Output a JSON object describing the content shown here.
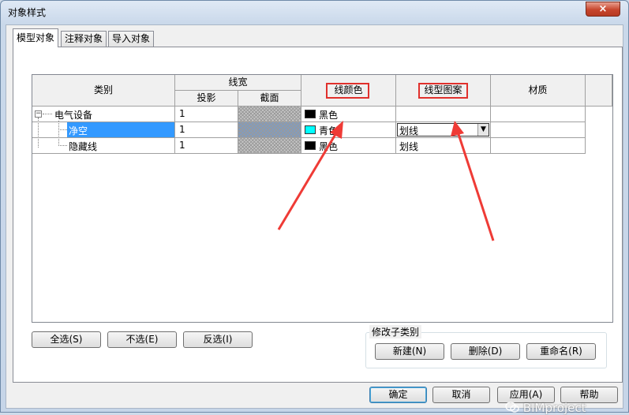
{
  "window": {
    "title": "对象样式",
    "close_icon": "×"
  },
  "tabs": [
    {
      "label": "模型对象",
      "active": true
    },
    {
      "label": "注释对象",
      "active": false
    },
    {
      "label": "导入对象",
      "active": false
    }
  ],
  "grid": {
    "headers": {
      "category": "类别",
      "line_weight": "线宽",
      "projection": "投影",
      "cut": "截面",
      "line_color": "线颜色",
      "line_pattern": "线型图案",
      "material": "材质"
    },
    "rows": [
      {
        "name": "电气设备",
        "projection": "1",
        "color_name": "黑色",
        "color_hex": "#000000",
        "pattern": "",
        "expander": "−"
      },
      {
        "name": "净空",
        "projection": "1",
        "color_name": "青色",
        "color_hex": "#00ffff",
        "pattern": "划线",
        "selected": true
      },
      {
        "name": "隐藏线",
        "projection": "1",
        "color_name": "黑色",
        "color_hex": "#000000",
        "pattern": "划线"
      }
    ]
  },
  "buttons": {
    "select_all": "全选(S)",
    "select_none": "不选(E)",
    "invert": "反选(I)",
    "modify_subcategory": "修改子类别",
    "new": "新建(N)",
    "delete": "删除(D)",
    "rename": "重命名(R)",
    "ok": "确定",
    "cancel": "取消",
    "apply": "应用(A)",
    "help": "帮助"
  },
  "watermark": "BIMproject",
  "colors": {
    "selection": "#3399ff",
    "annotation_red": "#e0302c"
  }
}
